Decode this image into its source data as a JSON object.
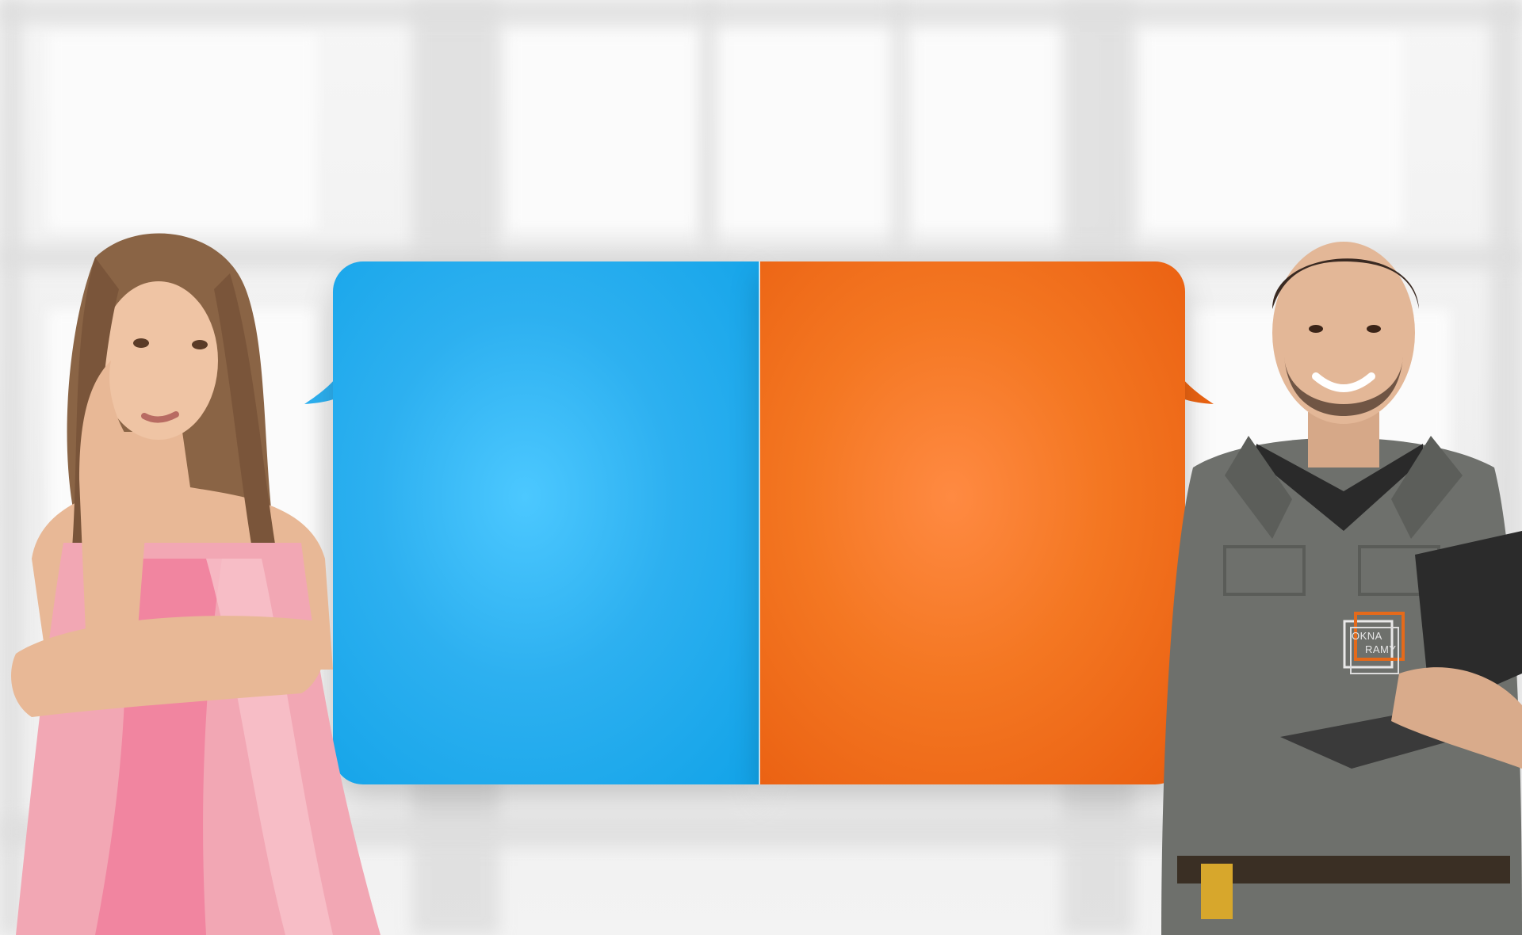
{
  "scene": {
    "background": "blurred-window-frames",
    "colors": {
      "left_bubble": "#2db0f0",
      "right_bubble": "#f47722",
      "background": "#f4f4f4"
    }
  },
  "left_bubble": {
    "text": ""
  },
  "right_bubble": {
    "text": ""
  },
  "logo": {
    "line1": "OKNA",
    "line2": "RAMY",
    "icon": "okna-ramy-logo"
  }
}
